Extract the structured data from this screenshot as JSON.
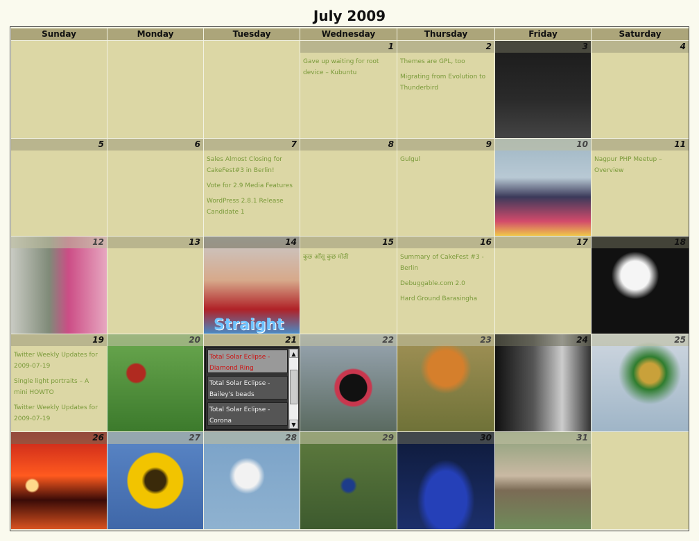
{
  "title": "July 2009",
  "weekdays": [
    "Sunday",
    "Monday",
    "Tuesday",
    "Wednesday",
    "Thursday",
    "Friday",
    "Saturday"
  ],
  "days": {
    "1": [
      "Gave up waiting for root device – Kubuntu"
    ],
    "2": [
      "Themes are GPL, too",
      "Migrating from Evolution to Thunderbird"
    ],
    "7": [
      "Sales Almost Closing for CakeFest#3 in Berlin!",
      "Vote for 2.9 Media Features",
      "WordPress 2.8.1 Release Candidate 1"
    ],
    "9": [
      "Gulgul"
    ],
    "11": [
      "Nagpur PHP Meetup – Overview"
    ],
    "15": [
      "कुछ आँसू कुछ मोती"
    ],
    "16": [
      "Summary of CakeFest #3 - Berlin",
      "Debuggable.com 2.0",
      "Hard Ground Barasingha"
    ],
    "19": [
      "Twitter Weekly Updates for 2009-07-19",
      "Single light portraits – A mini HOWTO",
      "Twitter Weekly Updates for 2009-07-19"
    ]
  },
  "popup_21": [
    "Total Solar Eclipse - Diamond Ring",
    "Total Solar Eclipse - Bailey's beads",
    "Total Solar Eclipse - Corona"
  ],
  "day_labels": {
    "1": "1",
    "2": "2",
    "3": "3",
    "4": "4",
    "5": "5",
    "6": "6",
    "7": "7",
    "8": "8",
    "9": "9",
    "10": "10",
    "11": "11",
    "12": "12",
    "13": "13",
    "14": "14",
    "15": "15",
    "16": "16",
    "17": "17",
    "18": "18",
    "19": "19",
    "20": "20",
    "21": "21",
    "22": "22",
    "23": "23",
    "24": "24",
    "25": "25",
    "26": "26",
    "27": "27",
    "28": "28",
    "29": "29",
    "30": "30",
    "31": "31"
  },
  "photos": {
    "3": "people-on-stage-photo",
    "10": "person-lying-on-bed-photo",
    "12": "girl-at-window-photo",
    "14": "straight-movie-poster-photo",
    "18": "white-flowers-photo",
    "20": "red-bird-on-branch-photo",
    "22": "butterfly-photo",
    "23": "tiger-photo",
    "24": "portrait-bw-photo",
    "25": "barbet-bird-photo",
    "26": "sunset-photo",
    "27": "sunflower-photo",
    "28": "tern-bird-photo",
    "29": "peacock-photo",
    "30": "dancer-photo",
    "31": "birds-on-branch-photo"
  },
  "poster_text": "Straight",
  "colors": {
    "header": "#aca57a",
    "cell": "#dcd7a5",
    "daynum": "#b9b58e",
    "link": "#7a9a3a"
  }
}
